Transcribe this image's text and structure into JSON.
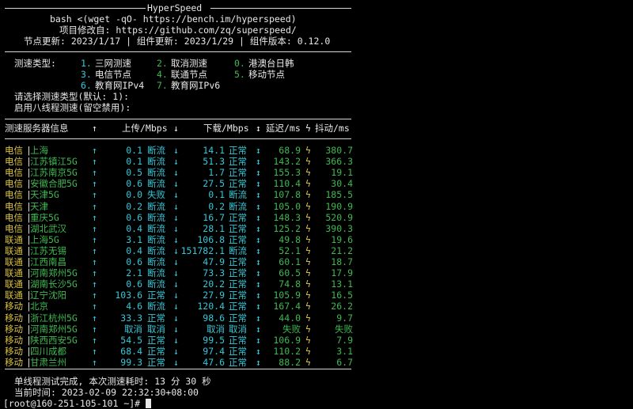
{
  "header": {
    "title": "HyperSpeed",
    "cmd": "bash <(wget -qO- https://bench.im/hyperspeed)",
    "modified": "项目修改自: https://github.com/zq/superspeed/",
    "versions": "节点更新: 2023/1/17 | 组件更新: 2023/1/29 | 组件版本: 0.12.0"
  },
  "menu": {
    "label": "测速类型:",
    "options": [
      {
        "num": "1.",
        "text": "三网测速"
      },
      {
        "num": "2.",
        "text": "取消测速"
      },
      {
        "num": "0.",
        "text": "港澳台日韩"
      },
      {
        "num": "3.",
        "text": "电信节点"
      },
      {
        "num": "4.",
        "text": "联通节点"
      },
      {
        "num": "5.",
        "text": "移动节点"
      },
      {
        "num": "6.",
        "text": "教育网IPv4"
      },
      {
        "num": "7.",
        "text": "教育网IPv6"
      }
    ],
    "prompt1": "请选择测速类型(默认: 1):",
    "prompt2": "启用八线程测速(留空禁用):"
  },
  "table": {
    "headers": {
      "server": "测速服务器信息",
      "arrow_up": "↑",
      "upload": "上传/Mbps",
      "arrow_down": "↓",
      "download": "下载/Mbps",
      "latency_icon": "↕",
      "latency": "延迟/ms",
      "jitter_icon": "ϟ",
      "jitter": "抖动/ms"
    },
    "rows": [
      {
        "isp": "电信",
        "loc": "上海",
        "up": "0.1",
        "upst": "断流",
        "down": "14.1",
        "downst": "正常",
        "lat": "68.9",
        "jit": "380.7"
      },
      {
        "isp": "电信",
        "loc": "江苏镇江5G",
        "up": "0.1",
        "upst": "断流",
        "down": "51.3",
        "downst": "正常",
        "lat": "143.2",
        "jit": "366.3"
      },
      {
        "isp": "电信",
        "loc": "江苏南京5G",
        "up": "0.5",
        "upst": "断流",
        "down": "1.7",
        "downst": "正常",
        "lat": "155.3",
        "jit": "19.1"
      },
      {
        "isp": "电信",
        "loc": "安徽合肥5G",
        "up": "0.6",
        "upst": "断流",
        "down": "27.5",
        "downst": "正常",
        "lat": "110.4",
        "jit": "30.4"
      },
      {
        "isp": "电信",
        "loc": "天津5G",
        "up": "0.0",
        "upst": "失败",
        "down": "0.1",
        "downst": "断流",
        "lat": "107.8",
        "jit": "185.5"
      },
      {
        "isp": "电信",
        "loc": "天津",
        "up": "0.2",
        "upst": "断流",
        "down": "0.2",
        "downst": "断流",
        "lat": "105.0",
        "jit": "190.9"
      },
      {
        "isp": "电信",
        "loc": "重庆5G",
        "up": "0.6",
        "upst": "断流",
        "down": "16.7",
        "downst": "正常",
        "lat": "148.3",
        "jit": "520.9"
      },
      {
        "isp": "电信",
        "loc": "湖北武汉",
        "up": "0.4",
        "upst": "断流",
        "down": "28.1",
        "downst": "正常",
        "lat": "125.2",
        "jit": "390.3"
      },
      {
        "isp": "联通",
        "loc": "上海5G",
        "up": "3.1",
        "upst": "断流",
        "down": "106.8",
        "downst": "正常",
        "lat": "49.8",
        "jit": "19.6"
      },
      {
        "isp": "联通",
        "loc": "江苏无锡",
        "up": "0.4",
        "upst": "断流",
        "down": "151782.1",
        "downst": "断流",
        "lat": "52.1",
        "jit": "21.2"
      },
      {
        "isp": "联通",
        "loc": "江西南昌",
        "up": "0.6",
        "upst": "断流",
        "down": "47.9",
        "downst": "正常",
        "lat": "60.1",
        "jit": "18.7"
      },
      {
        "isp": "联通",
        "loc": "河南郑州5G",
        "up": "2.1",
        "upst": "断流",
        "down": "73.3",
        "downst": "正常",
        "lat": "60.5",
        "jit": "17.9"
      },
      {
        "isp": "联通",
        "loc": "湖南长沙5G",
        "up": "0.6",
        "upst": "断流",
        "down": "20.2",
        "downst": "正常",
        "lat": "74.8",
        "jit": "13.1"
      },
      {
        "isp": "联通",
        "loc": "辽宁沈阳",
        "up": "103.6",
        "upst": "正常",
        "down": "27.9",
        "downst": "正常",
        "lat": "105.9",
        "jit": "16.5"
      },
      {
        "isp": "移动",
        "loc": "北京",
        "up": "4.6",
        "upst": "断流",
        "down": "120.4",
        "downst": "正常",
        "lat": "167.4",
        "jit": "26.2"
      },
      {
        "isp": "移动",
        "loc": "浙江杭州5G",
        "up": "33.3",
        "upst": "正常",
        "down": "98.6",
        "downst": "正常",
        "lat": "44.0",
        "jit": "9.7"
      },
      {
        "isp": "移动",
        "loc": "河南郑州5G",
        "up": "取消",
        "upst": "取消",
        "down": "取消",
        "downst": "取消",
        "lat": "失败",
        "jit": "失败"
      },
      {
        "isp": "移动",
        "loc": "陕西西安5G",
        "up": "54.5",
        "upst": "正常",
        "down": "99.5",
        "downst": "正常",
        "lat": "106.9",
        "jit": "7.9"
      },
      {
        "isp": "移动",
        "loc": "四川成都",
        "up": "68.4",
        "upst": "正常",
        "down": "97.4",
        "downst": "正常",
        "lat": "110.2",
        "jit": "3.1"
      },
      {
        "isp": "移动",
        "loc": "甘肃兰州",
        "up": "99.3",
        "upst": "正常",
        "down": "47.6",
        "downst": "正常",
        "lat": "88.2",
        "jit": "6.7"
      }
    ]
  },
  "footer": {
    "done": "单线程测试完成, 本次测速耗时: 13 分 30 秒",
    "time": "当前时间: 2023-02-09 22:32:30+08:00",
    "prompt": "[root@160-251-105-101 ~]# "
  },
  "colors": {
    "cyan": "#35c8d8",
    "green": "#3fb950",
    "yellow": "#d8c040",
    "background": "#000000"
  }
}
